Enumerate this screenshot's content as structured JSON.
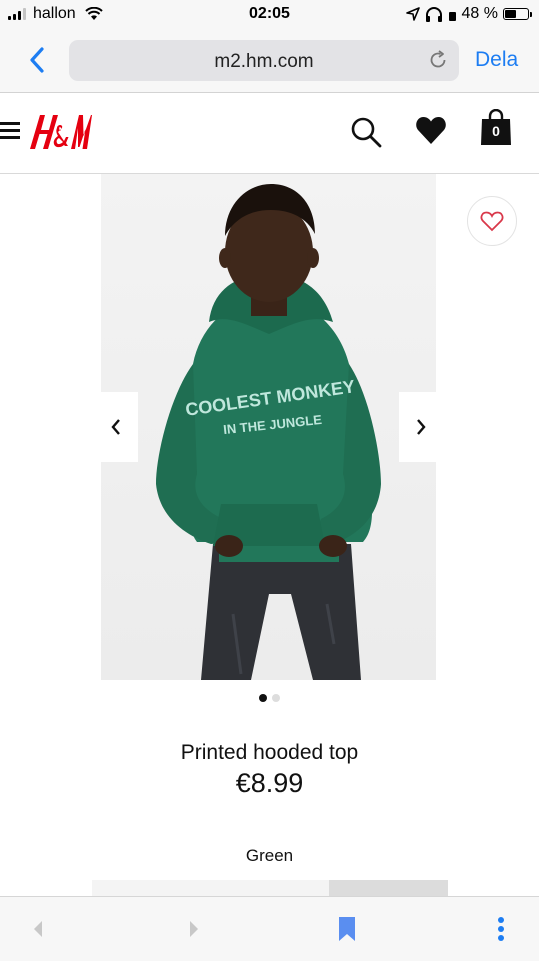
{
  "status_bar": {
    "carrier": "hallon",
    "time": "02:05",
    "battery_percent": "48 %",
    "battery_level": 0.48,
    "signal_bars": 4,
    "signal_bars_active": 3
  },
  "browser": {
    "url": "m2.hm.com",
    "share_label": "Dela",
    "accent_color": "#1d7df2"
  },
  "site": {
    "logo_text": "H&M",
    "brand_color": "#e50010",
    "bag_count": "0"
  },
  "gallery": {
    "image_count": 2,
    "active_index": 0,
    "hoodie_print_line1": "COOLEST MONKEY",
    "hoodie_print_line2": "IN THE JUNGLE",
    "hoodie_color": "#22775a"
  },
  "product": {
    "name": "Printed hooded top",
    "price": "€8.99",
    "color": "Green"
  },
  "icons": [
    "menu-icon",
    "search-icon",
    "heart-icon",
    "shopping-bag-icon",
    "chevron-left-icon",
    "chevron-right-icon",
    "bookmark-icon",
    "more-icon"
  ]
}
